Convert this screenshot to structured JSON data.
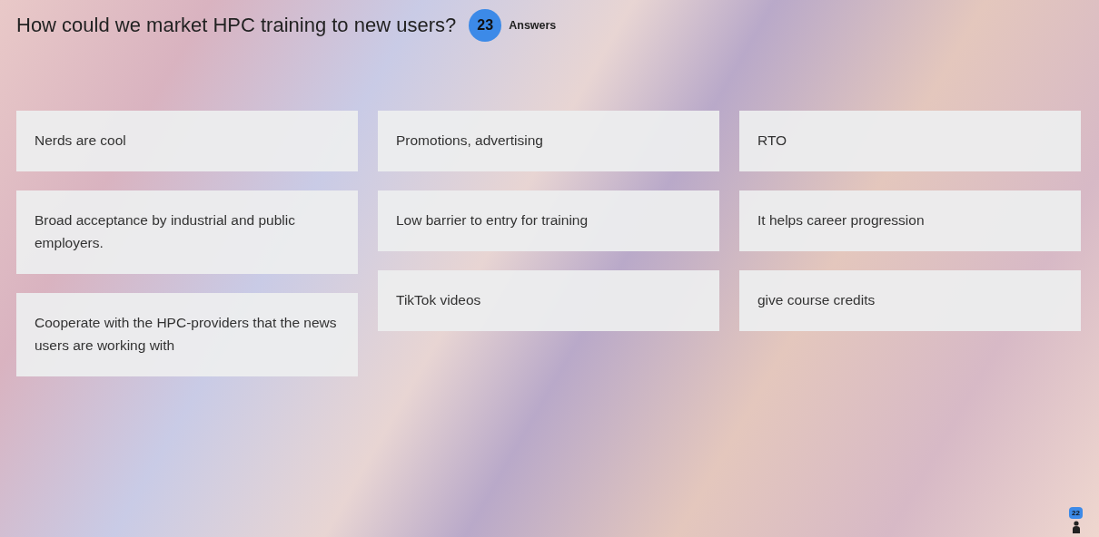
{
  "question": {
    "title": "How could we market HPC training to new users?",
    "answer_count": "23",
    "answer_label": "Answers"
  },
  "columns": [
    {
      "answers": [
        "Nerds are cool",
        "Broad acceptance by industrial and public employers.",
        "Cooperate with the HPC-providers that the news users are working with"
      ]
    },
    {
      "answers": [
        "Promotions, advertising",
        "Low barrier to entry for training",
        "TikTok videos"
      ]
    },
    {
      "answers": [
        "RTO",
        "It helps career progression",
        "give course credits"
      ]
    }
  ],
  "participants": {
    "count": "22"
  }
}
